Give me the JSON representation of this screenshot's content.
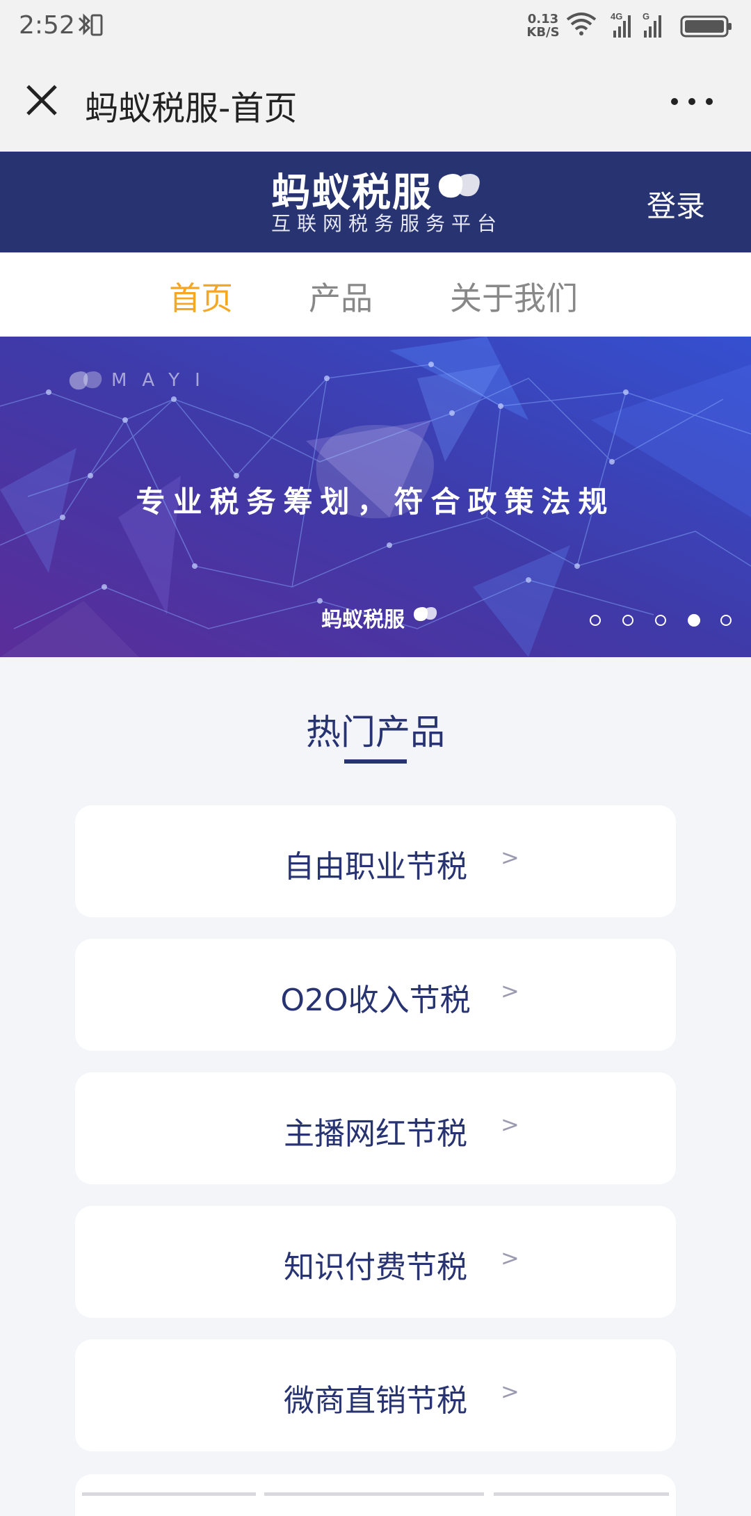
{
  "status_bar": {
    "time": "2:52",
    "speed_value": "0.13",
    "speed_unit": "KB/S",
    "net1": "4G",
    "net2": "G"
  },
  "nav_bar": {
    "title": "蚂蚁税服-首页"
  },
  "header": {
    "brand": "蚂蚁税服",
    "subtitle": "互联网税务服务平台",
    "login": "登录"
  },
  "tabs": [
    {
      "label": "首页",
      "active": true
    },
    {
      "label": "产品",
      "active": false
    },
    {
      "label": "关于我们",
      "active": false
    }
  ],
  "banner": {
    "watermark": "MAYI",
    "slogan": "专业税务筹划，符合政策法规",
    "brand": "蚂蚁税服",
    "slide_count": 5,
    "active_slide": 4
  },
  "section": {
    "title": "热门产品"
  },
  "products": [
    {
      "label": "自由职业节税",
      "arrow": ">"
    },
    {
      "label": "O2O收入节税",
      "arrow": ">"
    },
    {
      "label": "主播网红节税",
      "arrow": ">"
    },
    {
      "label": "知识付费节税",
      "arrow": ">"
    },
    {
      "label": "微商直销节税",
      "arrow": ">"
    }
  ],
  "colors": {
    "header_bg": "#283372",
    "accent": "#f5a623",
    "text_primary": "#283372"
  }
}
